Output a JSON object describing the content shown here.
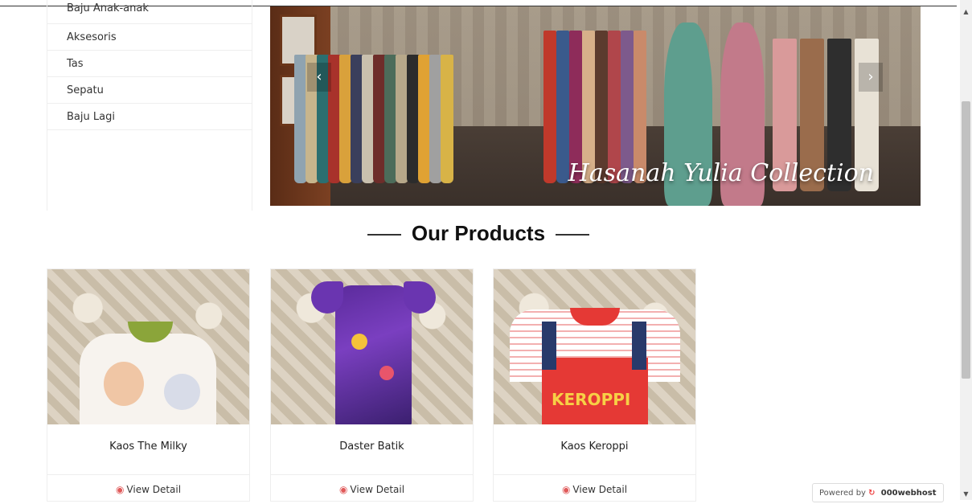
{
  "sidebar": {
    "items": [
      {
        "label": "Baju Anak-anak"
      },
      {
        "label": "Aksesoris"
      },
      {
        "label": "Tas"
      },
      {
        "label": "Sepatu"
      },
      {
        "label": "Baju Lagi"
      }
    ]
  },
  "banner": {
    "caption": "Hasanah Yulia Collection",
    "prev_icon": "chevron-left-icon",
    "next_icon": "chevron-right-icon"
  },
  "section": {
    "title": "Our Products"
  },
  "products": [
    {
      "name": "Kaos The Milky",
      "detail_label": "View Detail"
    },
    {
      "name": "Daster Batik",
      "detail_label": "View Detail"
    },
    {
      "name": "Kaos Keroppi",
      "detail_label": "View Detail"
    }
  ],
  "product_art": {
    "keroppi_text": "KEROPPI"
  },
  "footer_badge": {
    "prefix": "Powered by",
    "brand": "000webhost"
  },
  "colors": {
    "accent": "#e05a5a",
    "heading": "#111111"
  }
}
